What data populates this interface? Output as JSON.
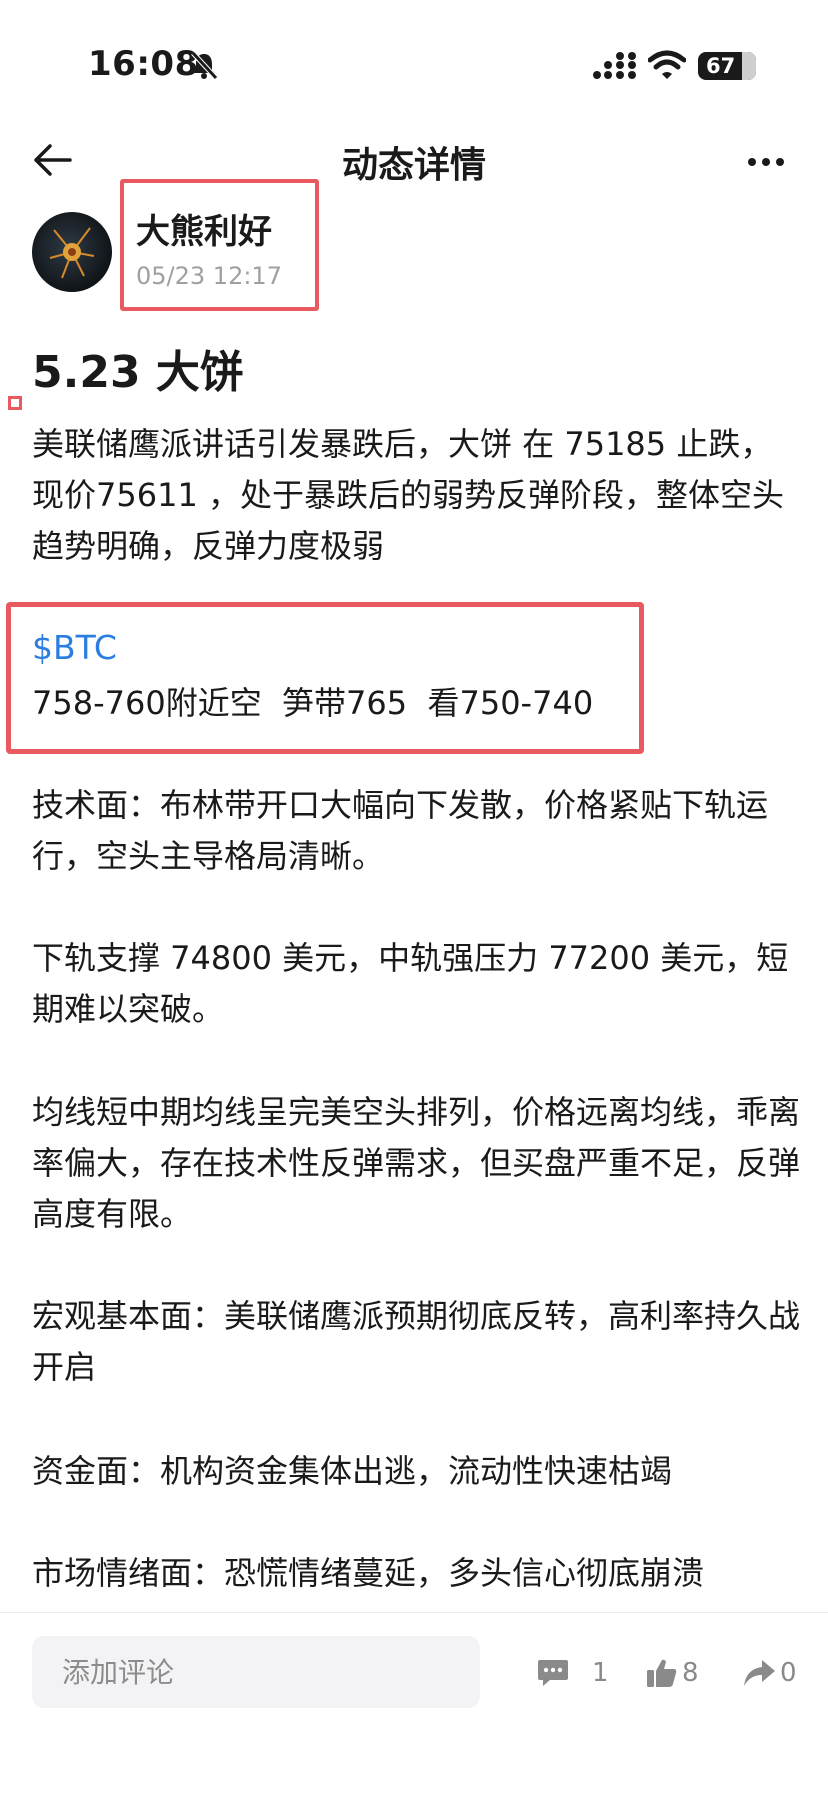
{
  "status_bar": {
    "time": "16:08",
    "battery": "67"
  },
  "nav": {
    "title": "动态详情"
  },
  "author": {
    "name": "大熊利好",
    "time": "05/23 12:17"
  },
  "post": {
    "title": "5.23 大饼",
    "intro": "美联储鹰派讲话引发暴跌后，大饼 在 75185 止跌，现价75611 ，处于暴跌后的弱势反弹阶段，整体空头趋势明确，反弹力度极弱",
    "ticker": "$BTC",
    "trade": "758-760附近空  笋带765  看750-740",
    "paragraphs": [
      "技术面：布林带开口大幅向下发散，价格紧贴下轨运行，空头主导格局清晰。",
      "下轨支撑 74800 美元，中轨强压力 77200 美元，短期难以突破。",
      "均线短中期均线呈完美空头排列，价格远离均线，乖离率偏大，存在技术性反弹需求，但买盘严重不足，反弹高度有限。",
      "宏观基本面：美联储鹰派预期彻底反转，高利率持久战开启",
      "资金面：机构资金集体出逃，流动性快速枯竭",
      "市场情绪面：恐慌情绪蔓延，多头信心彻底崩溃"
    ]
  },
  "bottom_bar": {
    "comment_placeholder": "添加评论",
    "comments": "1",
    "likes": "8",
    "shares": "0"
  },
  "colors": {
    "accent": "#2b7de0",
    "highlight_box": "#e85a5f"
  }
}
